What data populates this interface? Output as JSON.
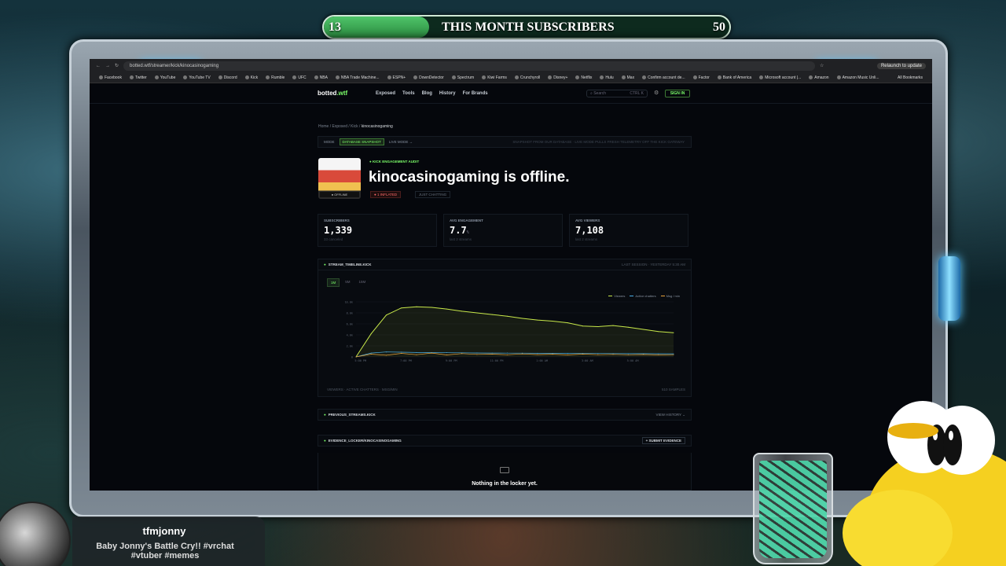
{
  "overlay": {
    "subs": {
      "current": "13",
      "title": "THIS MONTH SUBSCRIBERS",
      "goal": "50",
      "progress_fraction": 0.26
    },
    "profile": {
      "name": "tfmjonny",
      "desc_line1": "Baby Jonny's Battle Cry!! #vrchat",
      "desc_line2": "#vtuber #memes"
    }
  },
  "browser": {
    "url": "botted.wtf/streamer/kick/kinocasinogaming",
    "relaunch": "Relaunch to update",
    "bookmarks": [
      "Facebook",
      "Twitter",
      "YouTube",
      "YouTube TV",
      "Discord",
      "Kick",
      "Rumble",
      "UFC",
      "NBA",
      "NBA Trade Machine...",
      "ESPN+",
      "DownDetector",
      "Spectrum",
      "Kiwi Farms",
      "Crunchyroll",
      "Disney+",
      "Netflix",
      "Hulu",
      "Max",
      "Confirm account de...",
      "Factor",
      "Bank of America",
      "Microsoft account |...",
      "Amazon",
      "Amazon Music Unli..."
    ],
    "all_bookmarks": "All Bookmarks"
  },
  "site": {
    "logo_text": "botted",
    "logo_tld": ".wtf",
    "nav": [
      "Exposed",
      "Tools",
      "Blog",
      "History",
      "For Brands"
    ],
    "search_placeholder": "Search",
    "search_kbd": "CTRL K",
    "signin": "SIGN IN",
    "breadcrumb": {
      "a": "Home",
      "b": "Exposed",
      "c": "Kick",
      "current": "kinocasinogaming"
    },
    "mode": {
      "label": "MODE",
      "active": "DATABASE SNAPSHOT",
      "other": "LIVE MODE →",
      "note": "SNAPSHOT FROM OUR DATABASE · LIVE MODE PULLS FRESH TELEMETRY OFF THE KICK GATEWAY"
    },
    "audit_label": "● KICK ENGAGEMENT AUDIT",
    "avatar_status": "● OFFLINE",
    "title": "kinocasinogaming is offline.",
    "badge_inflated": "● 1 INFLATED",
    "badge_started": "JUST CHATTING",
    "stats": [
      {
        "label": "SUBSCRIBERS",
        "value": "1,339",
        "sub": "33 canceled"
      },
      {
        "label": "AVG ENGAGEMENT",
        "value": "7.7",
        "unit": "%",
        "sub": "last 2 streams"
      },
      {
        "label": "AVG VIEWERS",
        "value": "7,108",
        "sub": "last 2 streams"
      }
    ],
    "timeline": {
      "header": "STREAM_TIMELINE.KICK",
      "header_right": "LAST SESSION · YESTERDAY 5:30 AM",
      "tabs": [
        "1M",
        "5M",
        "15M"
      ],
      "legend": [
        "Viewers",
        "Active chatters",
        "Msg / min"
      ],
      "footer": "VIEWERS · ACTIVE CHATTERS · MSG/MIN",
      "footer_right": "510 SAMPLES"
    },
    "previous_streams": {
      "title": "PREVIOUS_STREAMS.KICK",
      "action": "VIEW HISTORY ⌄"
    },
    "evidence": {
      "title": "EVIDENCE_LOCKER/KINOCASINOGAMING",
      "button": "+ SUBMIT EVIDENCE",
      "empty": "Nothing in the locker yet."
    }
  },
  "chart_data": {
    "type": "line",
    "x": [
      "5:00 PM",
      "7:00 PM",
      "9:00 PM",
      "11:00 PM",
      "1:00 AM",
      "3:00 AM",
      "5:00 AM"
    ],
    "ylim": [
      0,
      10000
    ],
    "yticks": [
      "0",
      "2.0k",
      "4.0k",
      "6.0k",
      "8.0k",
      "10.0k"
    ],
    "series": [
      {
        "name": "Viewers",
        "color": "#c8e84a",
        "values": [
          0,
          4200,
          7600,
          8900,
          9100,
          9000,
          8700,
          8300,
          8000,
          7700,
          7400,
          7000,
          6700,
          6500,
          6200,
          5600,
          5500,
          5700,
          5400,
          5000,
          4600,
          4400
        ]
      },
      {
        "name": "Active chatters",
        "color": "#4ab0e8",
        "values": [
          0,
          700,
          900,
          850,
          800,
          780,
          760,
          740,
          720,
          700,
          690,
          680,
          660,
          650,
          640,
          620,
          610,
          600,
          590,
          580,
          570,
          560
        ]
      },
      {
        "name": "Msg / min",
        "color": "#e8a23a",
        "values": [
          0,
          500,
          300,
          650,
          400,
          700,
          350,
          600,
          450,
          500,
          380,
          550,
          420,
          480,
          360,
          520,
          400,
          450,
          380,
          430,
          360,
          400
        ]
      }
    ]
  }
}
